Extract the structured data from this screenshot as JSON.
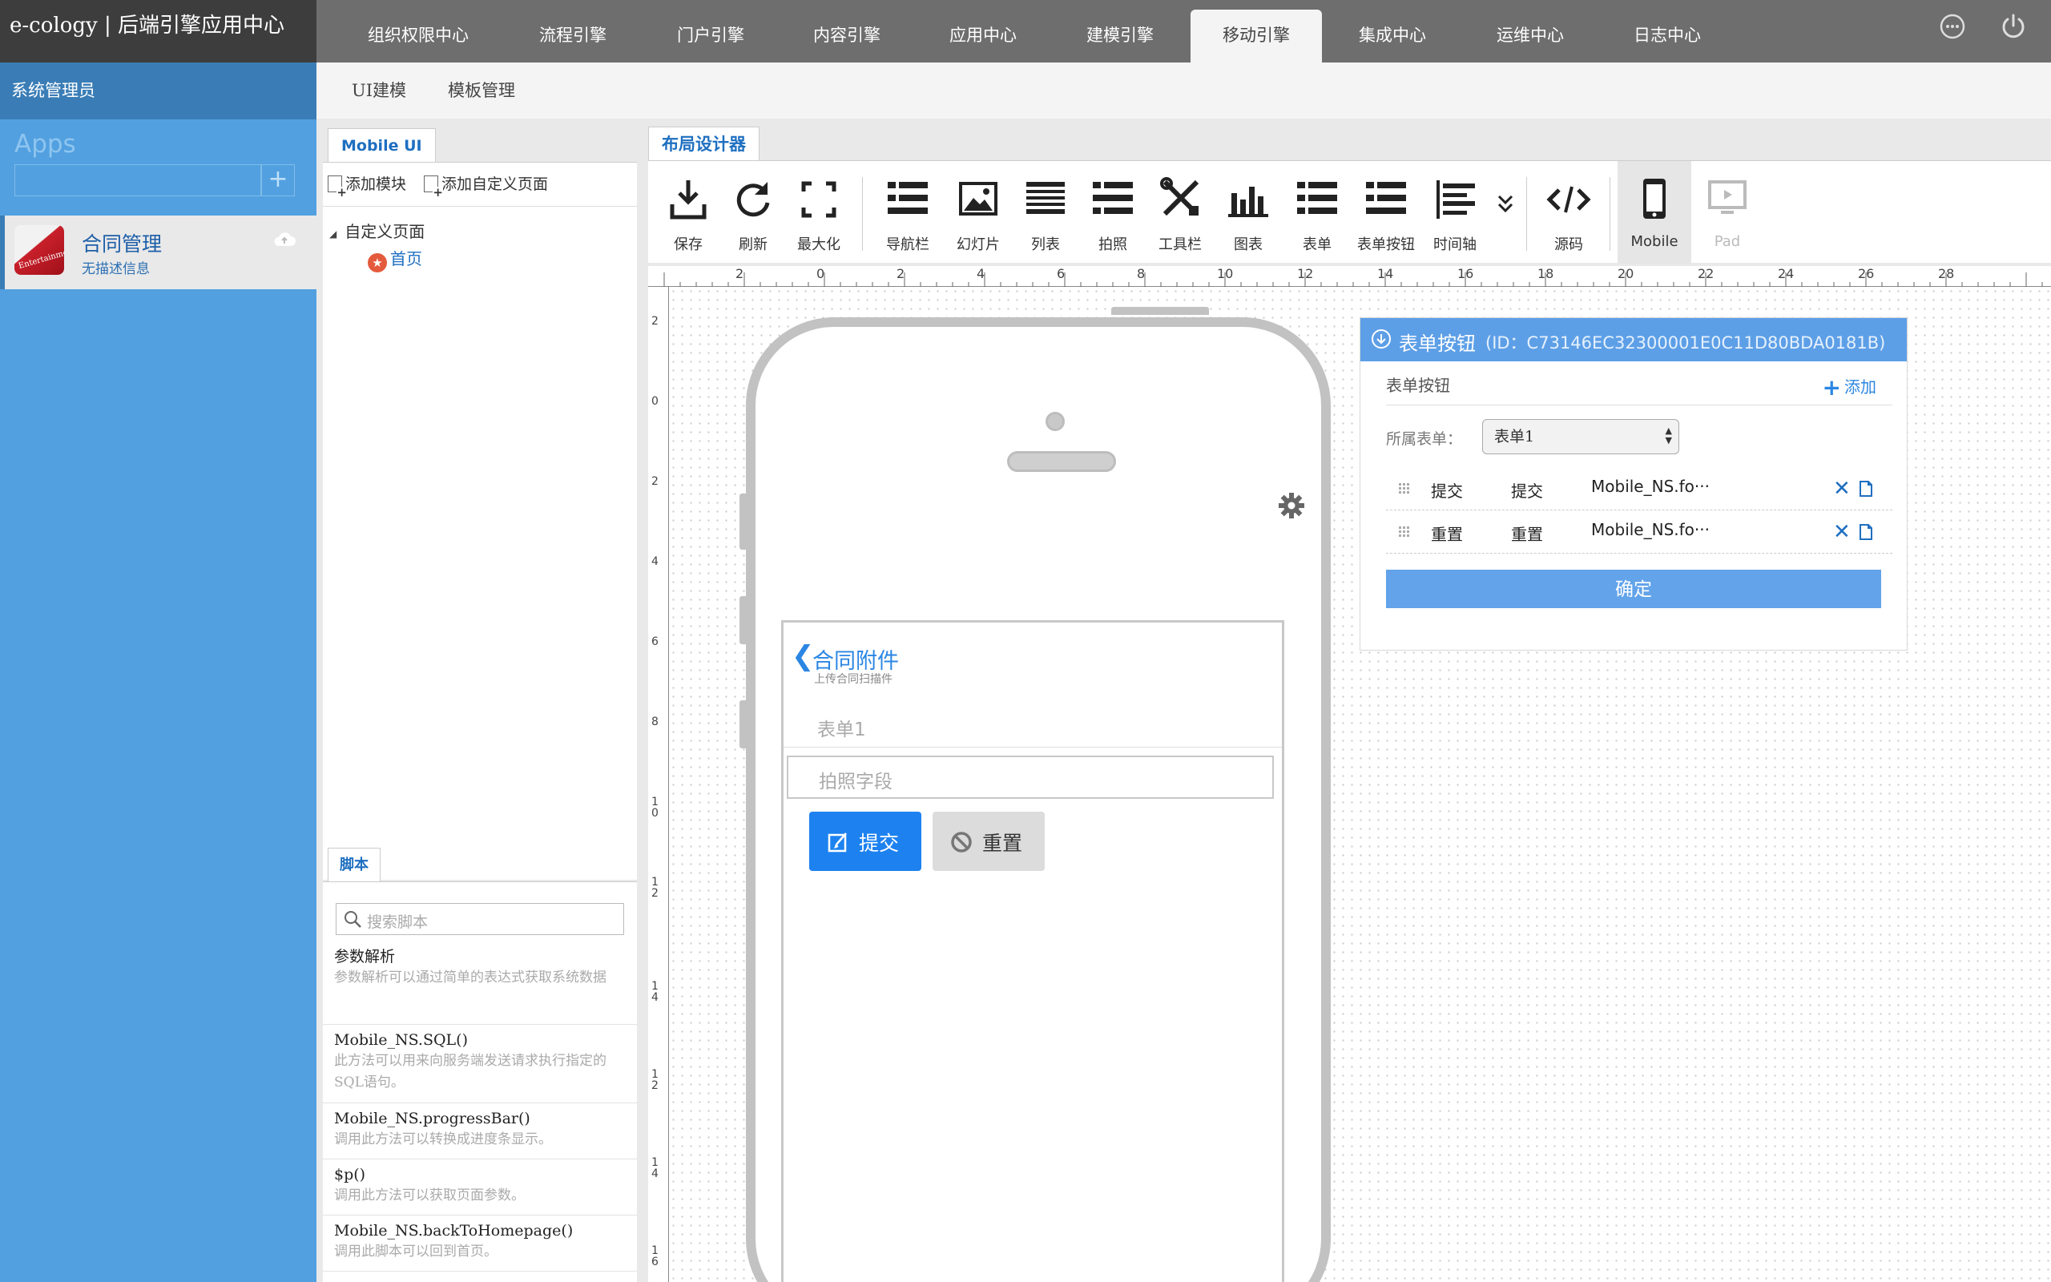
{
  "brand": "e-cology | 后端引擎应用中心",
  "nav": {
    "tabs": [
      "组织权限中心",
      "流程引擎",
      "门户引擎",
      "内容引擎",
      "应用中心",
      "建模引擎",
      "移动引擎",
      "集成中心",
      "运维中心",
      "日志中心"
    ],
    "active_tab": "移动引擎",
    "icons": [
      "more-icon",
      "power-icon"
    ]
  },
  "sidebar": {
    "user": "系统管理员",
    "apps_title": "Apps",
    "add_symbol": "+",
    "app": {
      "name": "合同管理",
      "description": "无描述信息",
      "icon_text": "Entertainment"
    }
  },
  "subtabs": [
    "UI建模",
    "模板管理"
  ],
  "left_panel": {
    "tab": "Mobile UI",
    "actions": [
      "添加模块",
      "添加自定义页面"
    ],
    "tree_root": "自定义页面",
    "tree_home": "首页",
    "script_tab": "脚本",
    "script_search_placeholder": "搜索脚本",
    "scripts": [
      {
        "name": "参数解析",
        "desc": "参数解析可以通过简单的表达式获取系统数据"
      },
      {
        "name": "Mobile_NS.SQL()",
        "desc": "此方法可以用来向服务端发送请求执行指定的SQL语句。"
      },
      {
        "name": "Mobile_NS.progressBar()",
        "desc": "调用此方法可以转换成进度条显示。"
      },
      {
        "name": "$p()",
        "desc": "调用此方法可以获取页面参数。"
      },
      {
        "name": "Mobile_NS.backToHomepage()",
        "desc": "调用此脚本可以回到首页。"
      }
    ]
  },
  "designer": {
    "tab": "布局设计器",
    "tools": [
      "保存",
      "刷新",
      "最大化",
      "导航栏",
      "幻灯片",
      "列表",
      "拍照",
      "工具栏",
      "图表",
      "表单",
      "表单按钮",
      "时间轴",
      "源码",
      "Mobile",
      "Pad"
    ],
    "active_device": "Mobile",
    "ruler_h": [
      "2",
      "0",
      "2",
      "4",
      "6",
      "8",
      "10",
      "12",
      "14",
      "16",
      "18",
      "20",
      "22",
      "24",
      "26",
      "28"
    ],
    "ruler_v": [
      "2",
      "0",
      "2",
      "4",
      "6",
      "8",
      "10",
      "12",
      "14",
      "12",
      "14",
      "16"
    ]
  },
  "phone_screen": {
    "back": "❮",
    "title": "合同附件",
    "subtitle": "上传合同扫描件",
    "form": "表单1",
    "field_placeholder": "拍照字段",
    "submit": "提交",
    "reset": "重置"
  },
  "properties": {
    "title": "表单按钮",
    "id_text": "(ID：C73146EC32300001E0C11D80BDA0181B)",
    "section": "表单按钮",
    "add": "添加",
    "form_label": "所属表单：",
    "form_value": "表单1",
    "rows": [
      {
        "c1": "提交",
        "c2": "提交",
        "c3": "Mobile_NS.fo···"
      },
      {
        "c1": "重置",
        "c2": "重置",
        "c3": "Mobile_NS.fo···"
      }
    ],
    "ok": "确定"
  },
  "colors": {
    "topbar": "#6e6e6e",
    "sidebar": "#52a0e0",
    "accent": "#1d82f0",
    "panel_head": "#5d9fe7"
  }
}
